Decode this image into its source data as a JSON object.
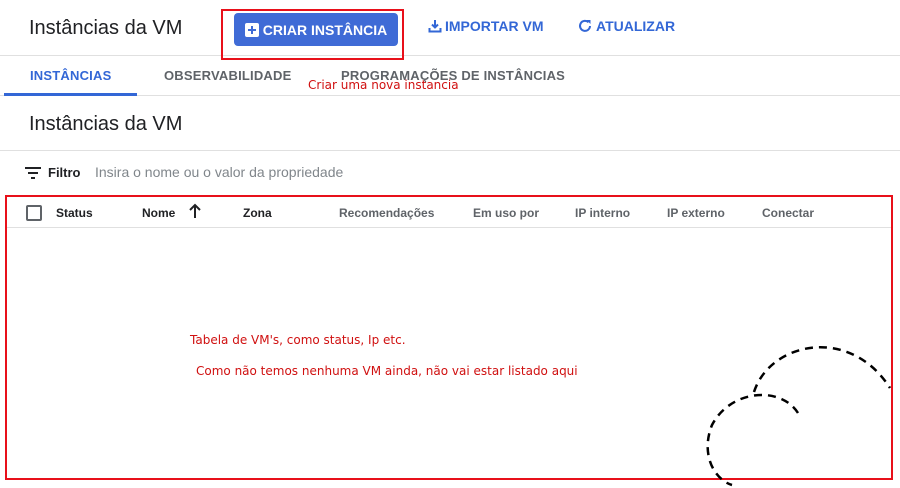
{
  "header": {
    "title": "Instâncias da VM",
    "create_button": "CRIAR INSTÂNCIA",
    "import_button": "IMPORTAR VM",
    "refresh_button": "ATUALIZAR"
  },
  "tabs": [
    {
      "label": "INSTÂNCIAS",
      "active": true
    },
    {
      "label": "OBSERVABILIDADE",
      "active": false
    },
    {
      "label": "PROGRAMAÇÕES DE INSTÂNCIAS",
      "active": false
    }
  ],
  "section": {
    "title": "Instâncias da VM"
  },
  "filter": {
    "label": "Filtro",
    "placeholder": "Insira o nome ou o valor da propriedade"
  },
  "table": {
    "columns": [
      "Status",
      "Nome",
      "Zona",
      "Recomendações",
      "Em uso por",
      "IP interno",
      "IP externo",
      "Conectar"
    ],
    "sorted_column": "Nome",
    "rows": []
  },
  "annotations": {
    "create_note": "Criar uma nova instancia",
    "table_note_1": "Tabela de VM's, como status, Ip etc.",
    "table_note_2": "Como não temos nenhuma VM ainda, não vai estar listado aqui"
  },
  "colors": {
    "accent": "#3367d6",
    "primary_button": "#3f6bd6",
    "annotation_red": "#e8101a"
  },
  "icons": {
    "create": "add-box-icon",
    "import": "download-icon",
    "refresh": "refresh-icon",
    "filter": "filter-list-icon",
    "sort": "arrow-upward-icon"
  }
}
